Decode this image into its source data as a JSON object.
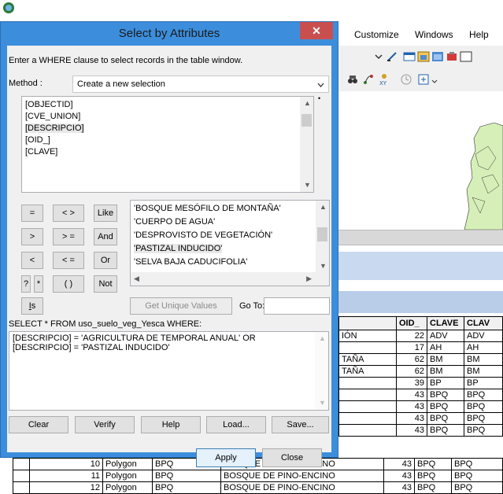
{
  "dialog": {
    "title": "Select by Attributes",
    "close_glyph": "✕",
    "instruction": "Enter a WHERE clause to select records in the table window.",
    "method_label": "Method :",
    "method_value": "Create a new selection",
    "fields": [
      "[OBJECTID]",
      "[CVE_UNION]",
      "[DESCRIPCIO]",
      "[OID_]",
      "[CLAVE]"
    ],
    "selected_field_index": 2,
    "operators": [
      "=",
      "< >",
      "Like",
      ">",
      "> =",
      "And",
      "<",
      "< =",
      "Or",
      "?",
      "*",
      "( )",
      "Not",
      "Is"
    ],
    "values": [
      "'BOSQUE MESÓFILO DE MONTAÑA'",
      "'CUERPO DE AGUA'",
      "'DESPROVISTO DE VEGETACIÓN'",
      "'PASTIZAL INDUCIDO'",
      "'SELVA BAJA CADUCIFOLIA'"
    ],
    "selected_value_index": 3,
    "get_unique_values": "Get Unique Values",
    "goto_label": "Go To:",
    "sql_prefix": "SELECT * FROM uso_suelo_veg_Yesca WHERE:",
    "query_line1": "[DESCRIPCIO] = 'AGRICULTURA DE TEMPORAL ANUAL' OR",
    "query_line2": "[DESCRIPCIO] = 'PASTIZAL INDUCIDO'",
    "buttons": {
      "clear": "Clear",
      "verify": "Verify",
      "help": "Help",
      "load": "Load...",
      "save": "Save...",
      "apply": "Apply",
      "close": "Close"
    }
  },
  "menus": [
    "Customize",
    "Windows",
    "Help"
  ],
  "table": {
    "headers": [
      "OID_",
      "CLAVE",
      "CLAV"
    ],
    "right_rows": [
      {
        "desc_frag": "IÓN",
        "oid": "22",
        "clave": "ADV",
        "clav": "ADV"
      },
      {
        "desc_frag": "",
        "oid": "17",
        "clave": "AH",
        "clav": "AH"
      },
      {
        "desc_frag": "TAÑA",
        "oid": "62",
        "clave": "BM",
        "clav": "BM"
      },
      {
        "desc_frag": "TAÑA",
        "oid": "62",
        "clave": "BM",
        "clav": "BM"
      },
      {
        "desc_frag": "",
        "oid": "39",
        "clave": "BP",
        "clav": "BP"
      },
      {
        "desc_frag": "",
        "oid": "43",
        "clave": "BPQ",
        "clav": "BPQ"
      },
      {
        "desc_frag": "",
        "oid": "43",
        "clave": "BPQ",
        "clav": "BPQ"
      },
      {
        "desc_frag": "",
        "oid": "43",
        "clave": "BPQ",
        "clav": "BPQ"
      },
      {
        "desc_frag": "",
        "oid": "43",
        "clave": "BPQ",
        "clav": "BPQ"
      }
    ],
    "bottom_rows": [
      {
        "fid": "10",
        "shape": "Polygon",
        "cve": "BPQ",
        "desc": "BOSQUE DE PINO-ENCINO",
        "oid": "43",
        "clave": "BPQ",
        "clav": "BPQ"
      },
      {
        "fid": "11",
        "shape": "Polygon",
        "cve": "BPQ",
        "desc": "BOSQUE DE PINO-ENCINO",
        "oid": "43",
        "clave": "BPQ",
        "clav": "BPQ"
      },
      {
        "fid": "12",
        "shape": "Polygon",
        "cve": "BPQ",
        "desc": "BOSQUE DE PINO-ENCINO",
        "oid": "43",
        "clave": "BPQ",
        "clav": "BPQ"
      }
    ]
  }
}
